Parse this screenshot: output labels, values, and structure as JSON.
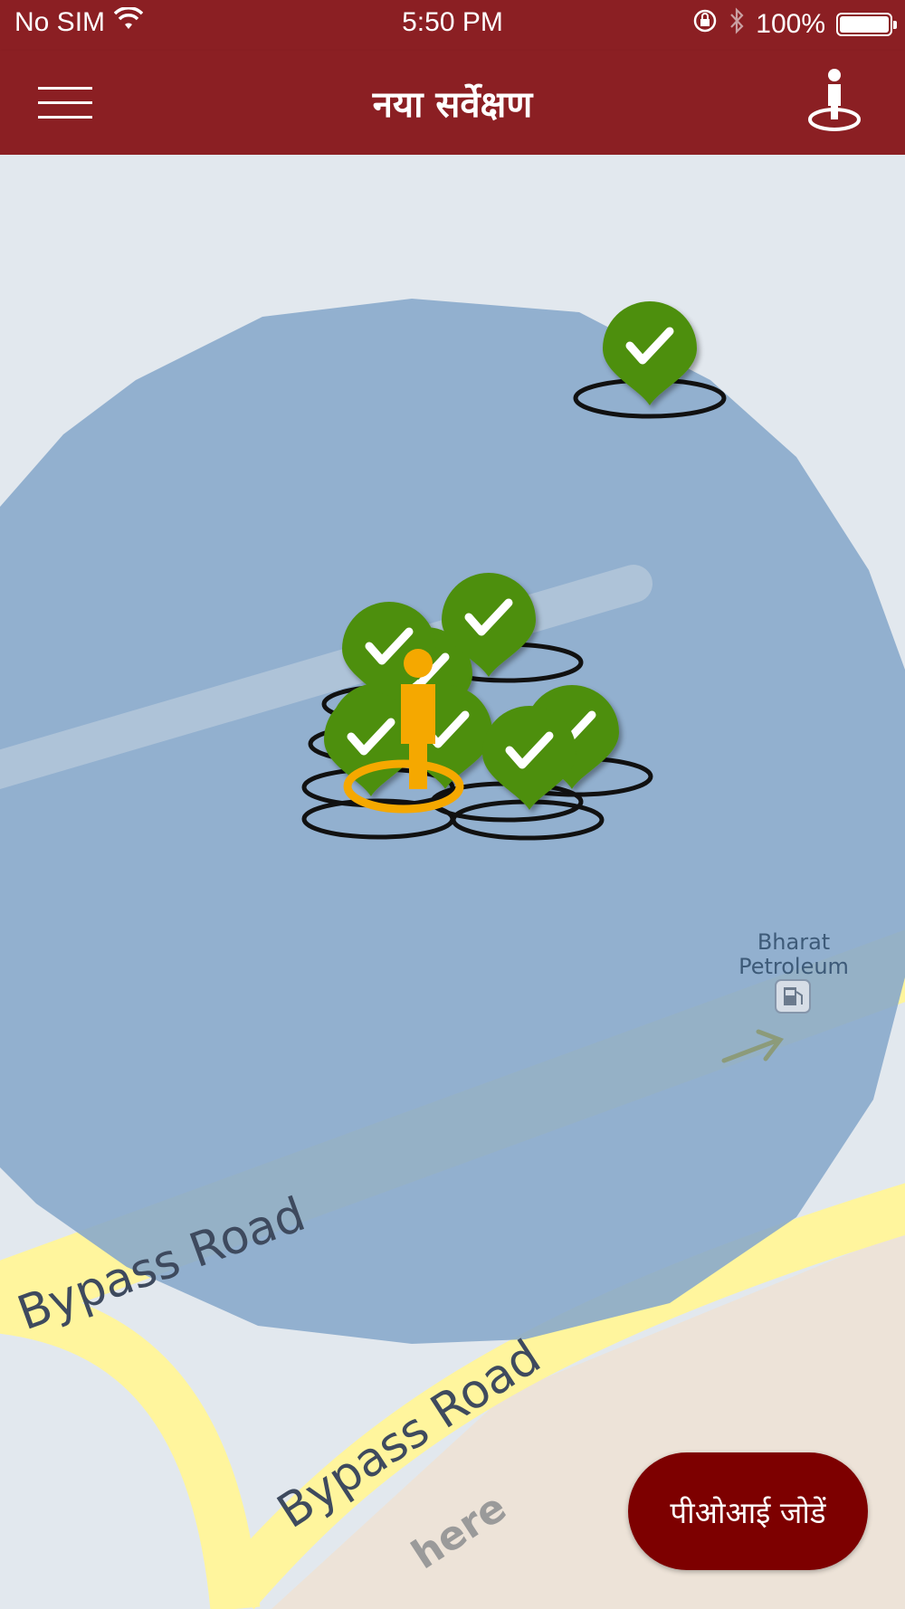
{
  "status_bar": {
    "carrier": "No SIM",
    "time": "5:50 PM",
    "battery_percent": "100%",
    "battery_level": 1.0,
    "icons": [
      "wifi-icon",
      "rotation-lock-icon",
      "bluetooth-icon",
      "battery-icon"
    ]
  },
  "nav": {
    "title": "नया सर्वेक्षण",
    "menu_icon": "hamburger-menu-icon",
    "locate_icon": "person-location-icon"
  },
  "map": {
    "roads": [
      {
        "name": "Bypass Road"
      },
      {
        "name": "Bypass Road"
      }
    ],
    "poi": {
      "name_line1": "Bharat",
      "name_line2": "Petroleum",
      "icon": "fuel-pump-icon"
    },
    "watermark": "here",
    "markers_visible": 10,
    "colors": {
      "accuracy_circle": "#8aaacb",
      "marker_green": "#4e8f10",
      "user_orange": "#f5a800",
      "road_yellow": "#fff59d",
      "land": "#ede3d8",
      "water_bg": "#e2e8ee"
    }
  },
  "actions": {
    "add_poi_label": "पीओआई जोडें"
  },
  "theme": {
    "header_color": "#8b1f23",
    "button_color": "#7d0000"
  }
}
